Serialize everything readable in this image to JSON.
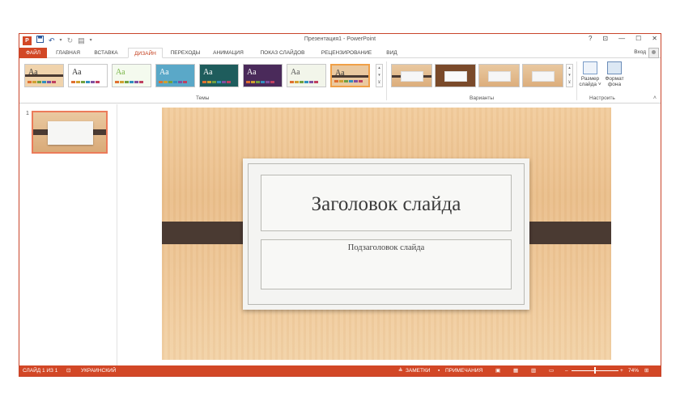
{
  "window": {
    "title": "Презентация1 - PowerPoint",
    "controls": [
      "?",
      "⊡",
      "—",
      "☐",
      "✕"
    ]
  },
  "qat": {
    "logo": "P",
    "save_icon": "save-icon",
    "undo_icon": "undo-icon",
    "redo_icon": "redo-icon"
  },
  "tabs": [
    {
      "label": "ФАЙЛ"
    },
    {
      "label": "ГЛАВНАЯ"
    },
    {
      "label": "ВСТАВКА"
    },
    {
      "label": "ДИЗАЙН"
    },
    {
      "label": "ПЕРЕХОДЫ"
    },
    {
      "label": "АНИМАЦИЯ"
    },
    {
      "label": "ПОКАЗ СЛАЙДОВ"
    },
    {
      "label": "РЕЦЕНЗИРОВАНИЕ"
    },
    {
      "label": "ВИД"
    }
  ],
  "account": {
    "signin": "Вход"
  },
  "ribbon": {
    "themes_label": "Темы",
    "variants_label": "Варианты",
    "customize_label": "Настроить",
    "themes": [
      {
        "aa": "Аа",
        "bg": "#f0d3ac",
        "fg": "#3a3a3a",
        "accent": "#4a3a32"
      },
      {
        "aa": "Аа",
        "bg": "#ffffff",
        "fg": "#333333",
        "accent": "#cccccc"
      },
      {
        "aa": "Аа",
        "bg": "#f4faee",
        "fg": "#7ab648",
        "accent": "#7ab648"
      },
      {
        "aa": "Аа",
        "bg": "#5aa8c8",
        "fg": "#ffffff",
        "accent": "#3b88b0"
      },
      {
        "aa": "Аа",
        "bg": "#1e5c5c",
        "fg": "#ffffff",
        "accent": "#e0a030"
      },
      {
        "aa": "Аа",
        "bg": "#4a2a5a",
        "fg": "#ffffff",
        "accent": "#c03060"
      },
      {
        "aa": "Аа",
        "bg": "#f2f5ea",
        "fg": "#555555",
        "accent": "#88aa44"
      },
      {
        "aa": "Аа",
        "bg": "#eac9a0",
        "fg": "#3a3a3a",
        "accent": "#4a3a32"
      }
    ],
    "slide_size": {
      "line1": "Размер",
      "line2": "слайда ˅"
    },
    "format_bg": {
      "line1": "Формат",
      "line2": "фона"
    }
  },
  "thumbs": {
    "number": "1"
  },
  "slide": {
    "title": "Заголовок слайда",
    "subtitle": "Подзаголовок слайда"
  },
  "status": {
    "slide_counter": "СЛАЙД 1 ИЗ 1",
    "language": "УКРАИНСКИЙ",
    "notes": "ЗАМЕТКИ",
    "comments": "ПРИМЕЧАНИЯ",
    "zoom_minus": "–",
    "zoom_plus": "+",
    "zoom": "74%",
    "zoom_fraction": 0.5
  },
  "colors": {
    "accent": "#d24726",
    "active_tab": "#c43e1c"
  }
}
